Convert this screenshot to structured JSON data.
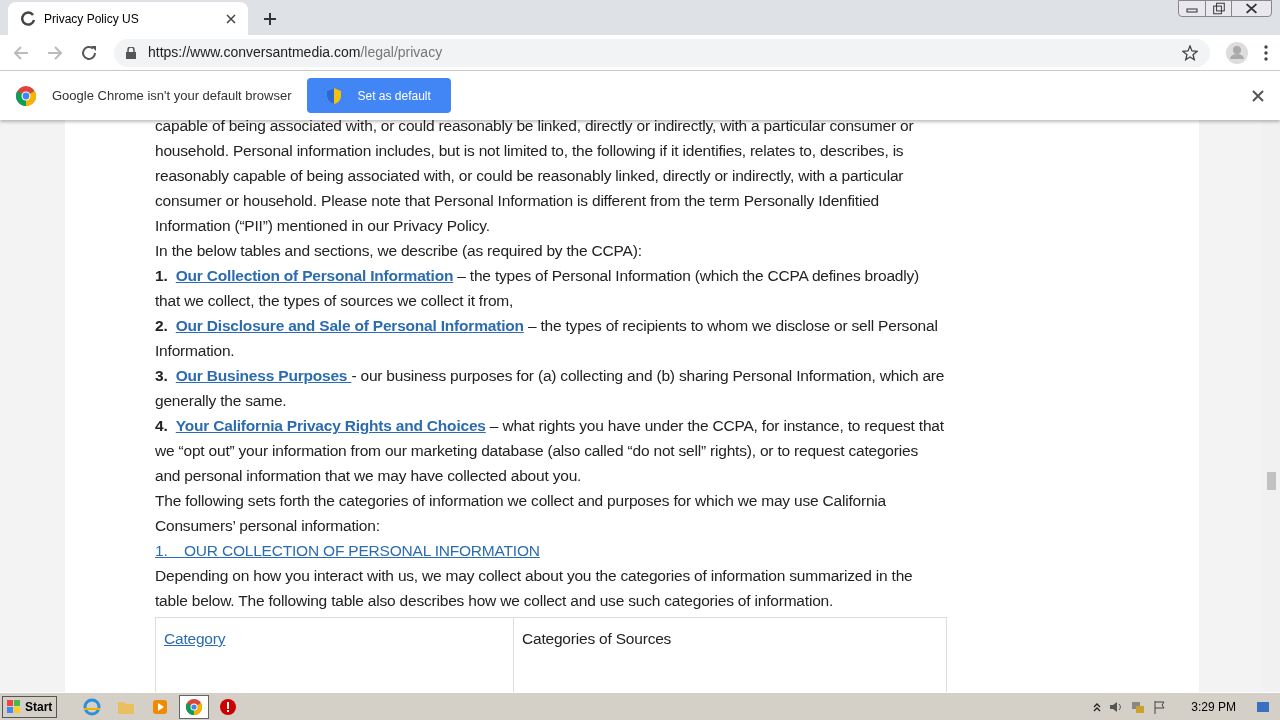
{
  "tab": {
    "title": "Privacy Policy US",
    "selected": true
  },
  "address": {
    "host": "https://www.conversantmedia.com",
    "path": "/legal/privacy"
  },
  "infobar": {
    "message": "Google Chrome isn't your default browser",
    "button": "Set as default"
  },
  "content": [
    {
      "kind": "paragraph",
      "text": "capable of being associated with, or could reasonably be linked, directly or indirectly, with a particular consumer or household. Personal information includes, but is not limited to, the following if it identifies, relates to, describes, is reasonably capable of being associated with, or could be reasonably linked, directly or indirectly, with a particular consumer or household.  Please note that Personal Information is different from the term Personally Idenfitied Information (“PII”) mentioned in our Privacy Policy."
    },
    {
      "kind": "paragraph",
      "text": "In the below tables and sections, we describe (as required by the CCPA):"
    },
    {
      "kind": "list_item",
      "number": "1.",
      "link": "Our Collection of Personal Information",
      "text": " – the types of Personal Information (which the CCPA defines broadly) that we collect, the types of sources we collect it from,"
    },
    {
      "kind": "list_item",
      "number": "2.",
      "link": "Our Disclosure and Sale of Personal Information",
      "text": " – the types of recipients to whom we disclose or sell Personal Information."
    },
    {
      "kind": "list_item",
      "number": "3.",
      "link": "Our Business Purposes ",
      "text": " - our business purposes for (a) collecting and (b) sharing Personal Information, which are generally the same."
    },
    {
      "kind": "list_item",
      "number": "4.",
      "link": "Your California Privacy Rights and Choices",
      "text": " – what rights you have under the CCPA, for instance, to request that we “opt out” your information from our marketing database (also called “do not sell” rights), or to request categories and personal information that we may have collected about you."
    },
    {
      "kind": "paragraph",
      "text": "The following sets forth the categories of information we collect and purposes for which we may use California Consumers’ personal information:"
    },
    {
      "kind": "heading_link",
      "text": "1.    OUR COLLECTION OF PERSONAL INFORMATION"
    },
    {
      "kind": "paragraph",
      "text": "Depending on how you interact with us, we may collect about you the categories of information summarized in the table below. The following table also describes how we collect and use such categories of information."
    }
  ],
  "table": {
    "columns": [
      {
        "label": "Category",
        "kind": "link"
      },
      {
        "label": "Categories of Sources",
        "kind": "text"
      }
    ]
  },
  "taskbar": {
    "start": "Start",
    "apps": [
      {
        "kind": "ie",
        "selected": false
      },
      {
        "kind": "folder",
        "selected": false
      },
      {
        "kind": "media",
        "selected": false
      },
      {
        "kind": "chrome",
        "selected": true
      },
      {
        "kind": "stop",
        "selected": false
      }
    ],
    "time": "3:29 PM"
  }
}
